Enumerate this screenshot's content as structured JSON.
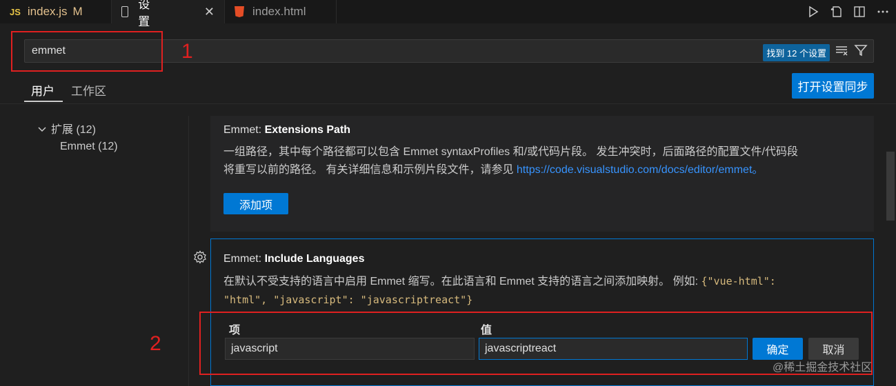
{
  "tabs": [
    {
      "badge": "JS",
      "label": "index.js",
      "status": "M"
    },
    {
      "label": "设置",
      "close": "✕"
    },
    {
      "label": "index.html"
    }
  ],
  "search": {
    "value": "emmet",
    "found_badge": "找到 12 个设置"
  },
  "annotations": {
    "one": "1",
    "two": "2"
  },
  "scope_tabs": {
    "user": "用户",
    "workspace": "工作区"
  },
  "sync_button": "打开设置同步",
  "toc": {
    "extensions": "扩展 (12)",
    "emmet": "Emmet (12)"
  },
  "setting1": {
    "prefix": "Emmet: ",
    "title": "Extensions Path",
    "desc_line1": "一组路径，其中每个路径都可以包含 Emmet syntaxProfiles 和/或代码片段。 发生冲突时，后面路径的配置文件/代码段",
    "desc_line2": "将重写以前的路径。 有关详细信息和示例片段文件，请参见 ",
    "link": "https://code.visualstudio.com/docs/editor/emmet。",
    "add_button": "添加项"
  },
  "setting2": {
    "prefix": "Emmet: ",
    "title": "Include Languages",
    "desc_line1": "在默认不受支持的语言中启用 Emmet 缩写。在此语言和 Emmet 支持的语言之间添加映射。 例如: ",
    "code_line1": "{\"vue-html\":",
    "code_line2": "\"html\", \"javascript\": \"javascriptreact\"}",
    "item_header": "项",
    "value_header": "值",
    "item_value": "javascript",
    "value_value": "javascriptreact",
    "ok_button": "确定",
    "cancel_button": "取消"
  },
  "watermark": "@稀土掘金技术社区",
  "colors": {
    "accent": "#0078d4",
    "annotation": "#e02020",
    "link": "#3794ff"
  }
}
